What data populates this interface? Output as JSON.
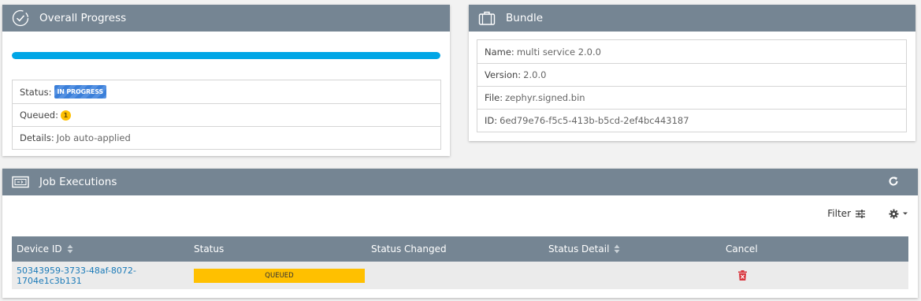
{
  "progress": {
    "title": "Overall Progress",
    "percent": 100,
    "rows": {
      "status_label": "Status:",
      "status_value": "IN PROGRESS",
      "queued_label": "Queued:",
      "queued_value": "1",
      "details_label": "Details:",
      "details_value": "Job auto-applied"
    }
  },
  "bundle": {
    "title": "Bundle",
    "rows": {
      "name_label": "Name:",
      "name_value": "multi service 2.0.0",
      "version_label": "Version:",
      "version_value": "2.0.0",
      "file_label": "File:",
      "file_value": "zephyr.signed.bin",
      "id_label": "ID:",
      "id_value": "6ed79e76-f5c5-413b-b5cd-2ef4bc443187"
    }
  },
  "jobs": {
    "title": "Job Executions",
    "filter_label": "Filter",
    "columns": [
      "Device ID",
      "Status",
      "Status Changed",
      "Status Detail",
      "Cancel"
    ],
    "rows": [
      {
        "device_id": "50343959-3733-48af-8072-1704e1c3b131",
        "status": "QUEUED",
        "status_changed": "",
        "status_detail": ""
      }
    ]
  },
  "colors": {
    "header_bg": "#758593",
    "progress": "#00a6e6",
    "queued": "#ffc000",
    "link": "#1a7ab8",
    "delete": "#d9363e"
  },
  "icons": [
    "check-circle-icon",
    "briefcase-icon",
    "job-executions-icon",
    "refresh-icon",
    "filter-icon",
    "gear-icon",
    "chevron-down-icon",
    "sort-icon",
    "trash-icon"
  ]
}
